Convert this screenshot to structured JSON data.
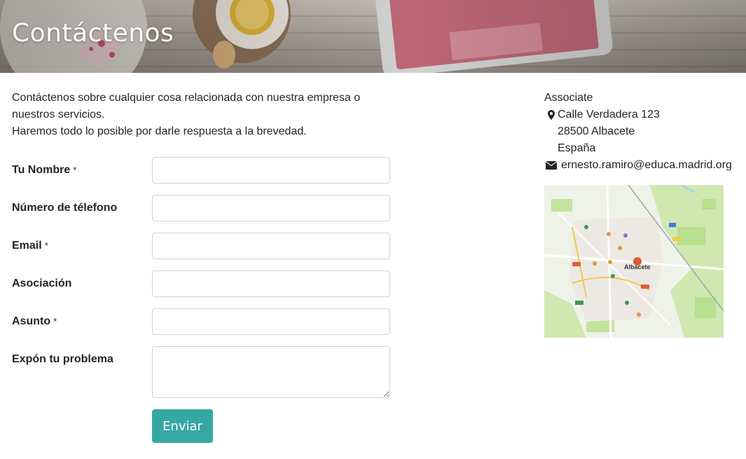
{
  "header": {
    "title": "Contáctenos"
  },
  "intro": {
    "line1": "Contáctenos sobre cualquier cosa relacionada con nuestra empresa o nuestros servicios.",
    "line2": "Haremos todo lo posible por darle respuesta a la brevedad."
  },
  "form": {
    "fields": [
      {
        "label": "Tu Nombre",
        "required_mark": "*",
        "value": ""
      },
      {
        "label": "Número de télefono",
        "required_mark": "",
        "value": ""
      },
      {
        "label": "Email",
        "required_mark": "*",
        "value": ""
      },
      {
        "label": "Asociación",
        "required_mark": "",
        "value": ""
      },
      {
        "label": "Asunto",
        "required_mark": "*",
        "value": ""
      },
      {
        "label": "Expón tu problema",
        "required_mark": "",
        "value": ""
      }
    ],
    "submit_label": "Enviar"
  },
  "contact": {
    "name": "Associate",
    "address_line1": "Calle Verdadera 123",
    "address_line2": "28500 Albacete",
    "address_line3": "España",
    "email": "ernesto.ramiro@educa.madrid.org",
    "icons": [
      "map-marker-icon",
      "envelope-icon"
    ]
  },
  "map": {
    "city_label": "Albacete",
    "colors": {
      "park": "#b7e08f",
      "road": "#ffffff",
      "highway": "#f2c94c",
      "marker": "#e05b3a",
      "water": "#a8d5f2"
    }
  },
  "theme": {
    "accent": "#36a8a3"
  }
}
